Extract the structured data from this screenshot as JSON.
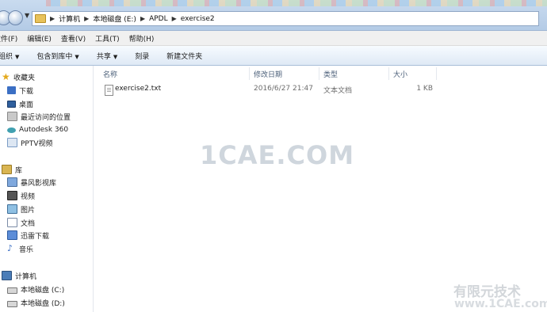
{
  "address_bar": {
    "path": [
      "计算机",
      "本地磁盘 (E:)",
      "APDL",
      "exercise2"
    ]
  },
  "menu": [
    "文件(F)",
    "编辑(E)",
    "查看(V)",
    "工具(T)",
    "帮助(H)"
  ],
  "toolbar": {
    "organize": "组织",
    "include_in_library": "包含到库中",
    "share": "共享",
    "burn": "刻录",
    "new_folder": "新建文件夹"
  },
  "nav": {
    "favorites": {
      "header": "收藏夹",
      "items": [
        "下载",
        "桌面",
        "最近访问的位置",
        "Autodesk 360",
        "PPTV视频"
      ]
    },
    "libraries": {
      "header": "库",
      "items": [
        "暴风影视库",
        "视频",
        "图片",
        "文档",
        "迅雷下载",
        "音乐"
      ]
    },
    "computer": {
      "header": "计算机",
      "items": [
        "本地磁盘 (C:)",
        "本地磁盘 (D:)"
      ]
    }
  },
  "columns": {
    "name": "名称",
    "modified": "修改日期",
    "type": "类型",
    "size": "大小"
  },
  "files": [
    {
      "name": "exercise2.txt",
      "modified": "2016/6/27 21:47",
      "type": "文本文档",
      "size": "1 KB"
    }
  ],
  "watermarks": {
    "center": "1CAE.COM",
    "corner_cn": "有限元技术",
    "corner_url": "www.1CAE.com"
  },
  "colors": {
    "address_bar_bg": "#b4cbe6",
    "toolbar_bg": "#dfe9f5",
    "header_text": "#4c607a"
  }
}
